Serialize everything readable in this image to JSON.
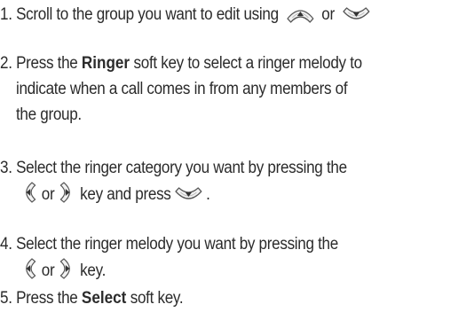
{
  "steps": [
    {
      "lines": [
        "1. Scroll to the group you want to edit using ",
        " or "
      ]
    },
    {
      "prefix": "2. Press the ",
      "keyword": "Ringer",
      "suffix": " soft key to select a ringer melody to",
      "line2": "indicate when a call comes in from any members of",
      "line3": "the group."
    },
    {
      "line1": "3. Select the ringer category you want by pressing the",
      "or": "or",
      "key_and_press": "key and press",
      "end": "."
    },
    {
      "line1": "4. Select the ringer melody you want by pressing the",
      "or": "or",
      "key": "key."
    },
    {
      "prefix": "5. Press the ",
      "keyword": "Select",
      "suffix": " soft key."
    }
  ],
  "icons": {
    "nav_up": "nav-up-key-icon",
    "nav_down": "nav-down-key-icon",
    "nav_left": "nav-left-key-icon",
    "nav_right": "nav-right-key-icon"
  }
}
